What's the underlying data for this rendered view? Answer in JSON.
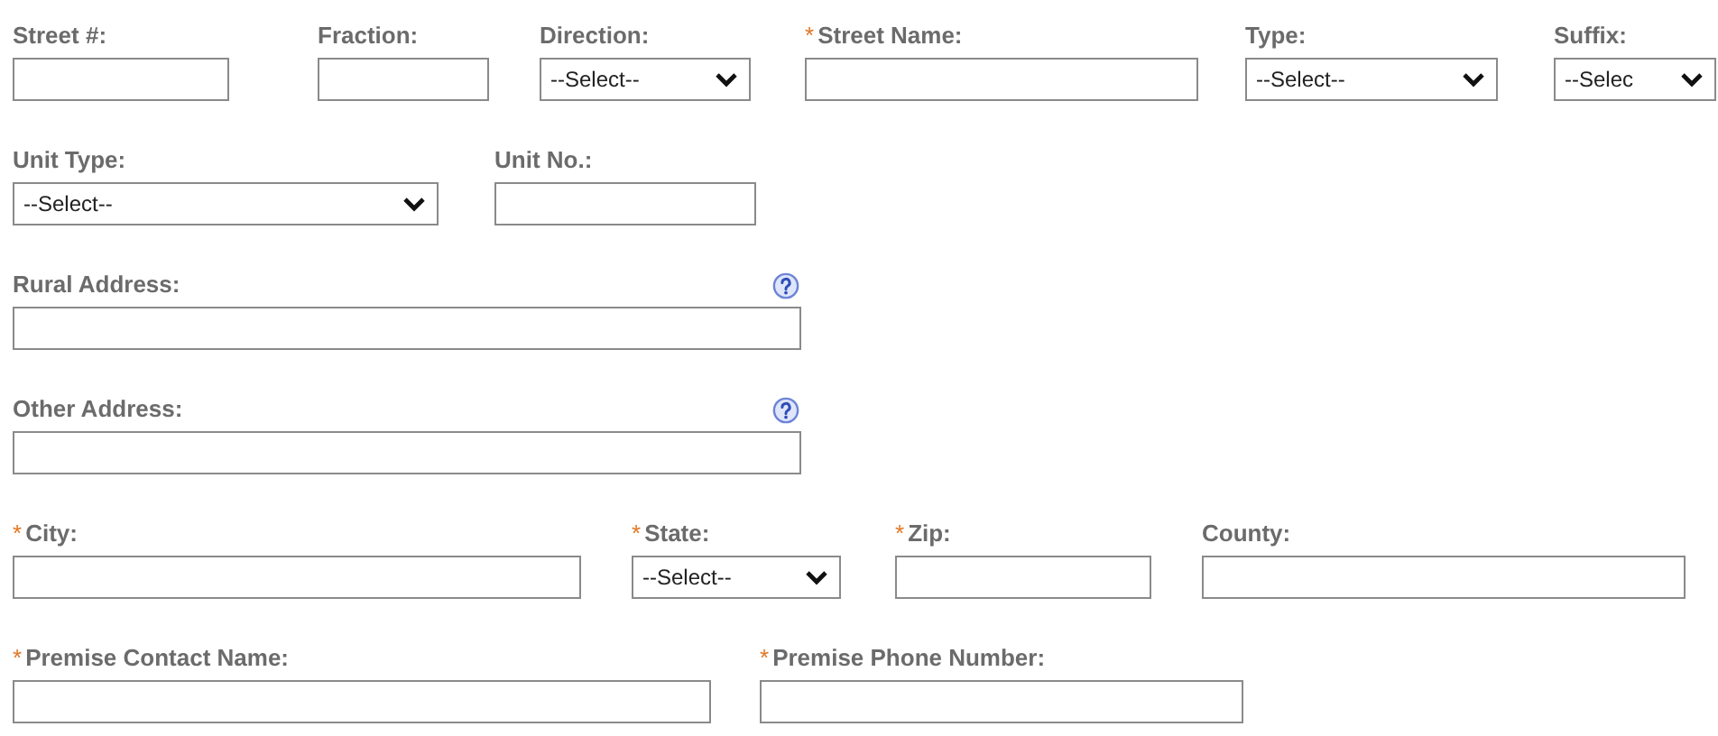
{
  "rows": [
    {
      "fields": [
        {
          "label": "Street #:",
          "kind": "text"
        },
        {
          "label": "Fraction:",
          "kind": "text"
        },
        {
          "label": "Direction:",
          "kind": "select",
          "value": "--Select--"
        },
        {
          "required_mark": "*",
          "label": "Street Name:",
          "kind": "text"
        },
        {
          "label": "Type:",
          "kind": "select",
          "value": "--Select--"
        },
        {
          "label": "Suffix:",
          "kind": "select",
          "value": "--Selec"
        }
      ]
    },
    {
      "fields": [
        {
          "label": "Unit Type:",
          "kind": "select",
          "value": "--Select--"
        },
        {
          "label": "Unit No.:",
          "kind": "text"
        }
      ]
    },
    {
      "fields": [
        {
          "label": "Rural Address:",
          "kind": "text",
          "help": true
        }
      ]
    },
    {
      "fields": [
        {
          "label": "Other Address:",
          "kind": "text",
          "help": true
        }
      ]
    },
    {
      "fields": [
        {
          "required_mark": "*",
          "label": "City:",
          "kind": "text"
        },
        {
          "required_mark": "*",
          "label": "State:",
          "kind": "select",
          "value": "--Select--"
        },
        {
          "required_mark": "*",
          "label": "Zip:",
          "kind": "text"
        },
        {
          "label": "County:",
          "kind": "text"
        }
      ]
    },
    {
      "fields": [
        {
          "required_mark": "*",
          "label": "Premise Contact Name:",
          "kind": "text"
        },
        {
          "required_mark": "*",
          "label": "Premise Phone Number:",
          "kind": "text"
        }
      ]
    }
  ]
}
